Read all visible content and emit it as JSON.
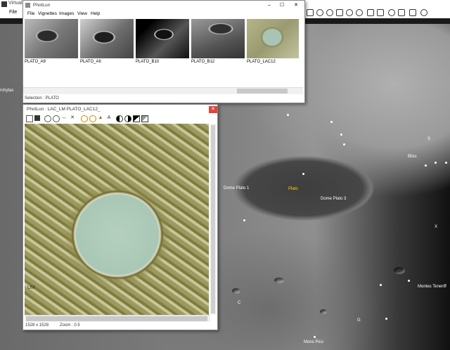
{
  "main_window": {
    "title": "Virtual M",
    "menu": {
      "file": "File"
    },
    "labels": {
      "archytas": "rchytas",
      "bliss": "Bliss",
      "dome_plato_1": "Dome Plato 1",
      "plato": "Plato",
      "dome_plato_3": "Dome Plato 3",
      "montes_teneriffe": "Montes Teneriff",
      "mons_pico": "Mons Pico",
      "g_label": "G",
      "c_label": "C",
      "s_label": "S",
      "x_label": "X"
    }
  },
  "photlun_window": {
    "title": "PhotLun",
    "menu": [
      "File",
      "Vignettes",
      "Images",
      "View",
      "Help"
    ],
    "controls": {
      "minimize": "–",
      "maximize": "☐",
      "close": "✕"
    },
    "thumbnails": [
      {
        "name": "PLATO_A9"
      },
      {
        "name": "PLATO_AII"
      },
      {
        "name": "PLATO_B10"
      },
      {
        "name": "PLATO_B12"
      },
      {
        "name": "PLATO_LAC12"
      }
    ],
    "selection": "Selection : PLATO"
  },
  "viewer_window": {
    "title": "PhotLun : LAC_LM  PLATO_LAC12_",
    "close": "✕",
    "status": {
      "size": "1528 x 1528",
      "zoom": "Zoom : 0.5"
    },
    "map_text": "UM"
  }
}
